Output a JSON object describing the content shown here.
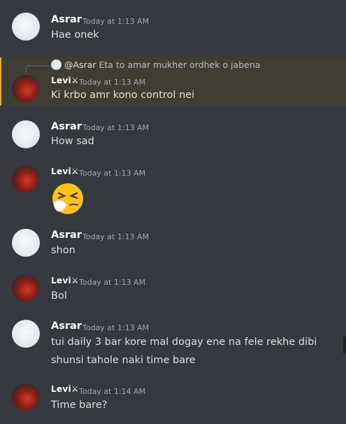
{
  "messages": [
    {
      "author": "Asrar",
      "time": "Today at 1:13 AM",
      "lines": [
        "Hae onek"
      ]
    },
    {
      "reply": {
        "author": "@Asrar",
        "text": "Eta to amar mukher ordhek o jabena"
      },
      "author": "Levi⚔",
      "time": "Today at 1:13 AM",
      "lines": [
        "Ki krbo amr kono control  nei"
      ]
    },
    {
      "author": "Asrar",
      "time": "Today at 1:13 AM",
      "lines": [
        "How sad"
      ]
    },
    {
      "author": "Levi⚔",
      "time": "Today at 1:13 AM",
      "emoji": "sneezing-face-emoji"
    },
    {
      "author": "Asrar",
      "time": "Today at 1:13 AM",
      "lines": [
        "shon"
      ]
    },
    {
      "author": "Levi⚔",
      "time": "Today at 1:13 AM",
      "lines": [
        "Bol"
      ]
    },
    {
      "author": "Asrar",
      "time": "Today at 1:13 AM",
      "lines": [
        "tui daily 3 bar kore mal dogay ene na fele rekhe dibi",
        "shunsi tahole naki time bare"
      ]
    },
    {
      "author": "Levi⚔",
      "time": "Today at 1:14 AM",
      "lines": [
        "Time bare?"
      ]
    }
  ],
  "colors": {
    "background": "#36393f",
    "reply_highlight": "#403e33",
    "reply_accent": "#faa81a"
  }
}
